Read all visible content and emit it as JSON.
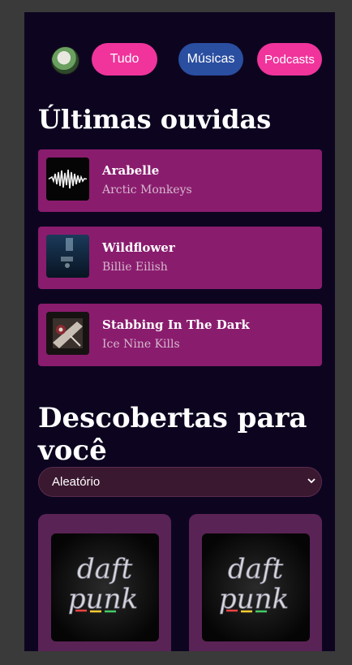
{
  "filters": {
    "all": "Tudo",
    "music": "Músicas",
    "podcasts": "Podcasts"
  },
  "recent": {
    "title": "Últimas ouvidas",
    "items": [
      {
        "title": "Arabelle",
        "artist": "Arctic Monkeys"
      },
      {
        "title": "Wildflower",
        "artist": "Billie Eilish"
      },
      {
        "title": "Stabbing In The Dark",
        "artist": "Ice Nine Kills"
      }
    ]
  },
  "discover": {
    "title": "Descobertas para você",
    "select": {
      "value": "Aleatório"
    },
    "cards": [
      {
        "art_text_1": "daft",
        "art_text_2": "punk"
      },
      {
        "art_text_1": "daft",
        "art_text_2": "punk"
      }
    ]
  },
  "colors": {
    "background": "#0d0520",
    "pink": "#f0349c",
    "blue": "#2a4ea0",
    "track_bg": "#8a1c6e",
    "card_bg": "#5a2356"
  }
}
